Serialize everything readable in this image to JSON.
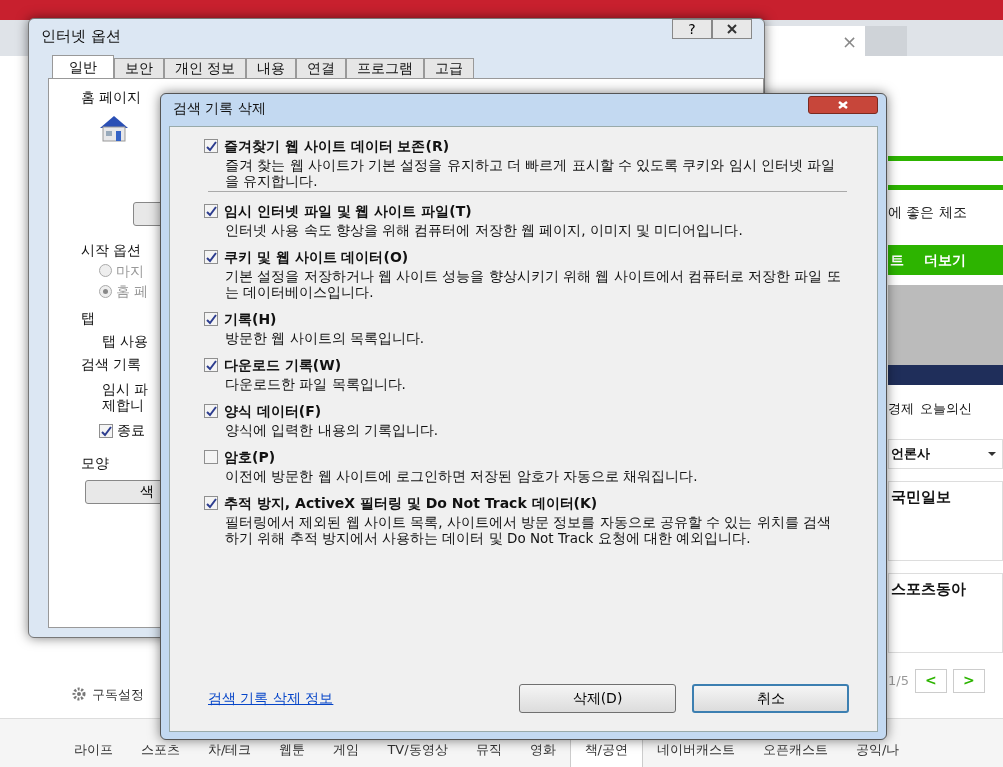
{
  "browser": {
    "tab_close": "×",
    "banner_text": "에 좋은 체조",
    "menu": [
      {
        "label": "트"
      },
      {
        "label": "더보기"
      }
    ],
    "news_links": [
      "경제",
      "오늘의신"
    ],
    "press_select": "언론사",
    "papers": [
      "국민일보",
      "스포츠동아"
    ],
    "subscribe": "구독설정",
    "pager": "1/5",
    "prev": "<",
    "next": ">",
    "categories": [
      {
        "label": "라이프",
        "selected": false
      },
      {
        "label": "스포츠",
        "selected": false
      },
      {
        "label": "차/테크",
        "selected": false
      },
      {
        "label": "웹툰",
        "selected": false
      },
      {
        "label": "게임",
        "selected": false
      },
      {
        "label": "TV/동영상",
        "selected": false
      },
      {
        "label": "뮤직",
        "selected": false
      },
      {
        "label": "영화",
        "selected": false
      },
      {
        "label": "책/공연",
        "selected": true
      },
      {
        "label": "네이버캐스트",
        "selected": false
      },
      {
        "label": "오픈캐스트",
        "selected": false
      },
      {
        "label": "공익/나",
        "selected": false
      }
    ]
  },
  "options_window": {
    "title": "인터넷 옵션",
    "help": "?",
    "tabs": [
      {
        "label": "일반",
        "selected": true
      },
      {
        "label": "보안",
        "selected": false
      },
      {
        "label": "개인 정보",
        "selected": false
      },
      {
        "label": "내용",
        "selected": false
      },
      {
        "label": "연결",
        "selected": false
      },
      {
        "label": "프로그램",
        "selected": false
      },
      {
        "label": "고급",
        "selected": false
      }
    ],
    "home_page": "홈 페이지",
    "start_options": "시작 옵션",
    "radios": [
      {
        "label": "마지",
        "selected": false
      },
      {
        "label": "홈 페",
        "selected": true
      }
    ],
    "tabs_heading": "탭",
    "tabs_text": "탭 사용",
    "history_heading": "검색 기록",
    "history_text": "임시 파",
    "history_text_2": "제합니",
    "exit_checkbox": {
      "label": "종료",
      "checked": true
    },
    "appearance": "모양",
    "color_button": "색"
  },
  "dialog": {
    "title": "검색 기록 삭제",
    "items": [
      {
        "label": "즐겨찾기 웹 사이트 데이터 보존(R)",
        "description": "즐겨 찾는 웹 사이트가 기본 설정을 유지하고 더 빠르게 표시할 수 있도록 쿠키와 임시 인터넷 파일을 유지합니다.",
        "checked": true
      },
      {
        "label": "임시 인터넷 파일 및 웹 사이트 파일(T)",
        "description": "인터넷 사용 속도 향상을 위해 컴퓨터에 저장한 웹 페이지, 이미지 및 미디어입니다.",
        "checked": true
      },
      {
        "label": "쿠키 및 웹 사이트 데이터(O)",
        "description": "기본 설정을 저장하거나 웹 사이트 성능을 향상시키기 위해 웹 사이트에서 컴퓨터로 저장한 파일 또는 데이터베이스입니다.",
        "checked": true
      },
      {
        "label": "기록(H)",
        "description": "방문한 웹 사이트의 목록입니다.",
        "checked": true
      },
      {
        "label": "다운로드 기록(W)",
        "description": "다운로드한 파일 목록입니다.",
        "checked": true
      },
      {
        "label": "양식 데이터(F)",
        "description": "양식에 입력한 내용의 기록입니다.",
        "checked": true
      },
      {
        "label": "암호(P)",
        "description": "이전에 방문한 웹 사이트에 로그인하면 저장된 암호가 자동으로 채워집니다.",
        "checked": false
      },
      {
        "label": "추적 방지, ActiveX 필터링 및 Do Not Track 데이터(K)",
        "description": "필터링에서 제외된 웹 사이트 목록, 사이트에서 방문 정보를 자동으로 공유할 수 있는 위치를 검색하기 위해 추적 방지에서 사용하는 데이터 및 Do Not Track 요청에 대한 예외입니다.",
        "checked": true
      }
    ],
    "info_link": "검색 기록 삭제 정보",
    "buttons": [
      {
        "label": "삭제(D)",
        "default": false
      },
      {
        "label": "취소",
        "default": true
      }
    ]
  }
}
